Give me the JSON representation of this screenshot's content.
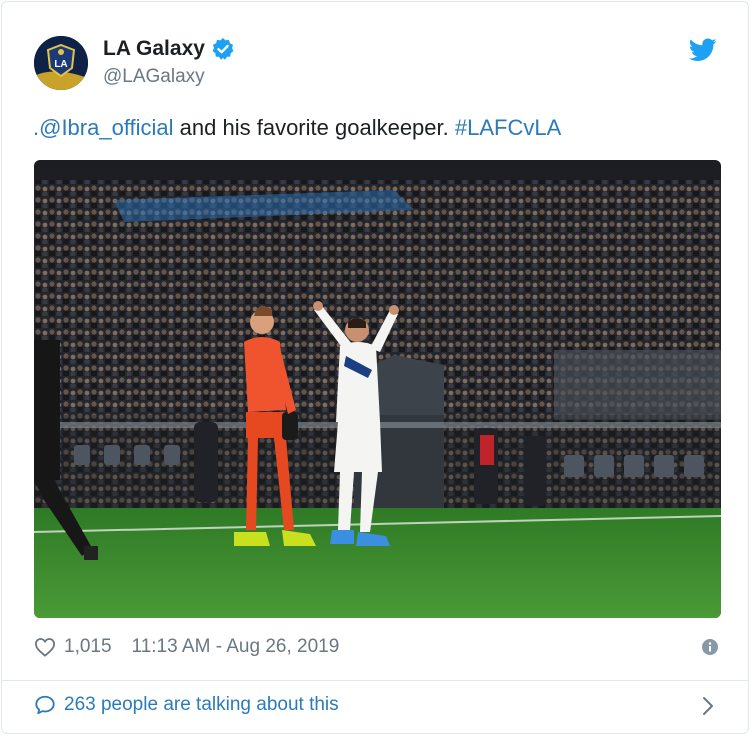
{
  "author": {
    "name": "LA Galaxy",
    "handle": "@LAGalaxy",
    "avatar_logo_text": "LA",
    "verified_icon": "verified-badge-icon"
  },
  "tweet": {
    "mention": ".@Ibra_official",
    "text_middle": " and his favorite goalkeeper. ",
    "hashtag": "#LAFCvLA"
  },
  "stats": {
    "like_count": "1,015",
    "timestamp": "11:13 AM - Aug 26, 2019"
  },
  "conversation": {
    "label": "263 people are talking about this"
  },
  "colors": {
    "link": "#2b7bb9",
    "twitter_blue": "#1da1f2",
    "muted": "#697882",
    "pitch": "#3f8a2e",
    "keeper_kit": "#f0542e"
  }
}
